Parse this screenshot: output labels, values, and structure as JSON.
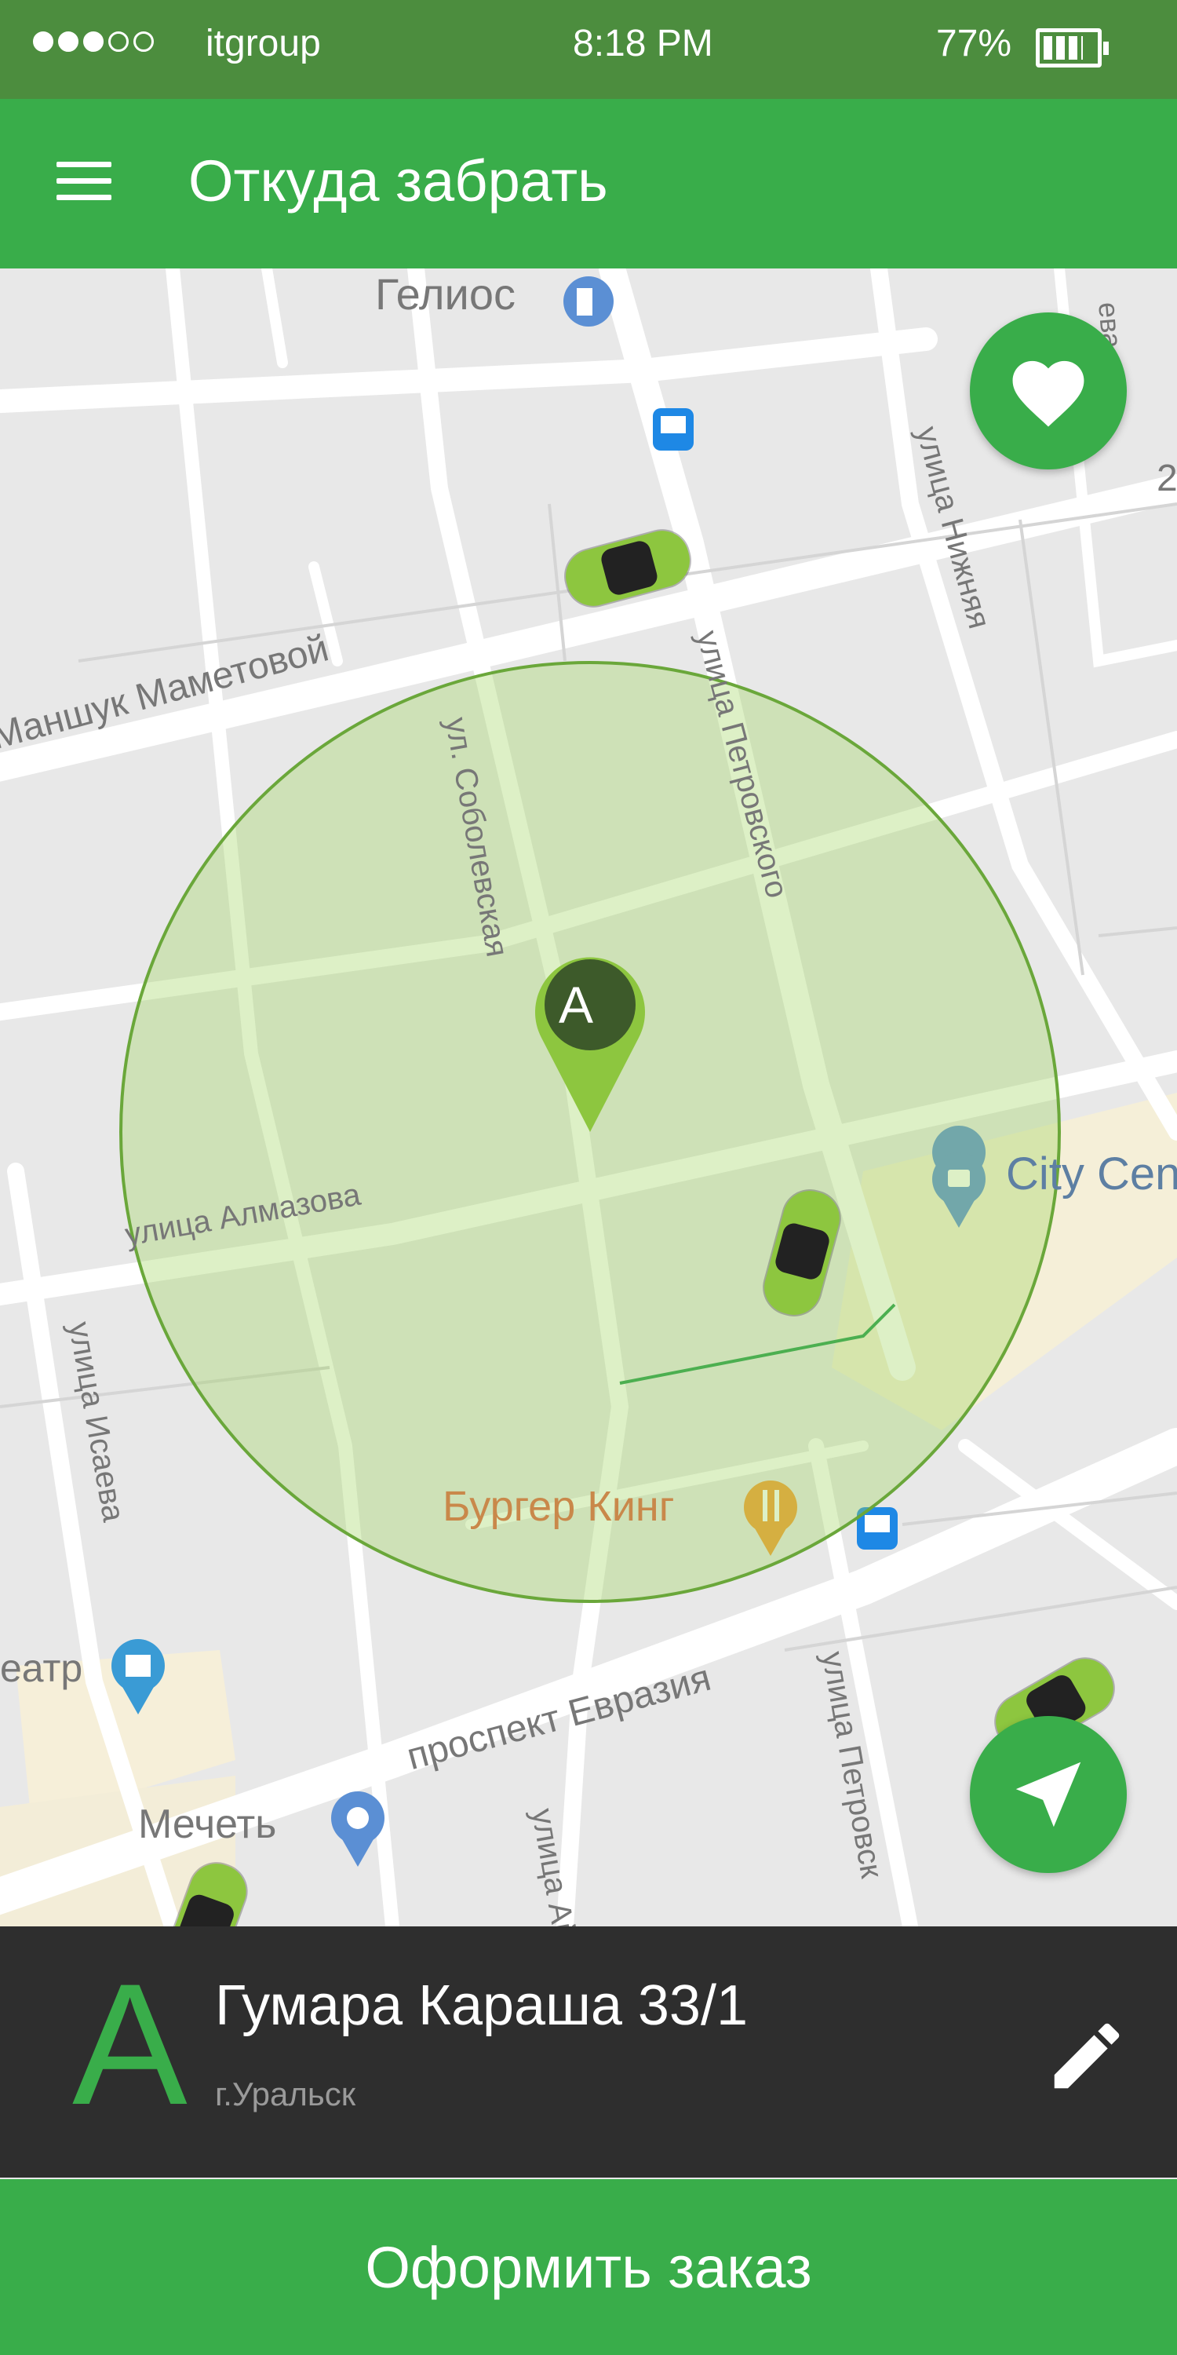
{
  "status_bar": {
    "carrier": "itgroup",
    "time": "8:18 PM",
    "battery_percent": "77%",
    "signal_strength": 3,
    "signal_max": 5
  },
  "app_bar": {
    "title": "Откуда забрать",
    "menu_icon": "hamburger-menu-icon"
  },
  "map": {
    "labels": {
      "helios": "Гелиос",
      "manshuk": "Маншук Маметовой",
      "sobolevskaya": "ул. Соболевская",
      "petrovskogo": "улица Петровского",
      "nizhnyaya": "улица Нижняя",
      "almazova": "улица Алмазова",
      "isaeva": "улица Исаева",
      "city_center": "City Cen",
      "burger_king": "Бургер Кинг",
      "prospekt": "проспект Евразия",
      "petrovskogo2": "улица Петровск",
      "mechet": "Мечеть",
      "teatr": "еатр",
      "street_ait": "улица Айт",
      "edge_eva": "ева",
      "edge_2": "2"
    },
    "pin_letter": "A",
    "colors": {
      "radius_fill": "#9fd35b",
      "pin": "#8dc63f",
      "car": "#8dc63f"
    }
  },
  "fab": {
    "favorites_icon": "heart-icon",
    "locate_icon": "navigation-arrow-icon"
  },
  "address_panel": {
    "letter": "A",
    "address": "Гумара Караша 33/1",
    "city": "г.Уральск",
    "edit_icon": "pencil-icon"
  },
  "order_button": {
    "label": "Оформить заказ"
  },
  "colors": {
    "primary": "#39ad4a",
    "status_bar": "#4c8d3e",
    "panel": "#2e2e2e"
  }
}
